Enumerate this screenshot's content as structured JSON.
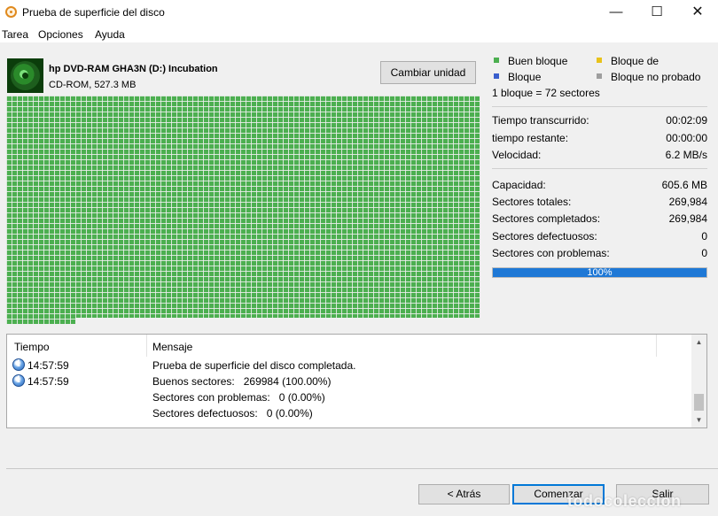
{
  "window": {
    "title": "Prueba de superficie del disco",
    "minimize_glyph": "—",
    "maximize_glyph": "☐",
    "close_glyph": "✕"
  },
  "menu": [
    "Tarea",
    "Opciones",
    "Ayuda"
  ],
  "drive": {
    "icon": "cd-disc-icon",
    "name": "hp DVD-RAM GHA3N (D:) Incubation",
    "sub": "CD-ROM, 527.3 MB",
    "change_button": "Cambiar unidad"
  },
  "block_map": {
    "good_color": "#4caf50",
    "completed_fraction": 1.0
  },
  "legend": [
    {
      "label": "Buen bloque",
      "color": "#4caf50"
    },
    {
      "label": "Bloque de",
      "color": "#e8c21a"
    },
    {
      "label": "Bloque",
      "color": "#3a5fcd"
    },
    {
      "label": "Bloque no probado",
      "color": "#9e9e9e"
    }
  ],
  "block_size": "1 bloque = 72 sectores",
  "stats_time": [
    {
      "label": "Tiempo transcurrido:",
      "value": "00:02:09"
    },
    {
      "label": "tiempo restante:",
      "value": "00:00:00"
    },
    {
      "label": "Velocidad:",
      "value": "6.2 MB/s"
    }
  ],
  "stats_disk": [
    {
      "label": "Capacidad:",
      "value": "605.6 MB"
    },
    {
      "label": "Sectores totales:",
      "value": "269,984"
    },
    {
      "label": "Sectores completados:",
      "value": "269,984"
    },
    {
      "label": "Sectores defectuosos:",
      "value": "0"
    },
    {
      "label": "Sectores con problemas:",
      "value": "0"
    }
  ],
  "progress": {
    "percent": 100,
    "text": "100%",
    "color": "#1e78d6"
  },
  "log": {
    "headers": {
      "time": "Tiempo",
      "message": "Mensaje"
    },
    "rows": [
      {
        "icon": "info-icon",
        "time": "14:57:59",
        "message": "Prueba de superficie del disco completada."
      },
      {
        "icon": "info-icon",
        "time": "14:57:59",
        "message": "Buenos sectores:   269984 (100.00%)"
      },
      {
        "icon": "",
        "time": "",
        "message": "Sectores con problemas:   0 (0.00%)"
      },
      {
        "icon": "",
        "time": "",
        "message": "Sectores defectuosos:   0 (0.00%)"
      }
    ]
  },
  "buttons": {
    "back": "< Atrás",
    "start": "Comenzar",
    "exit": "Salir"
  },
  "watermark": "todocoleccion"
}
